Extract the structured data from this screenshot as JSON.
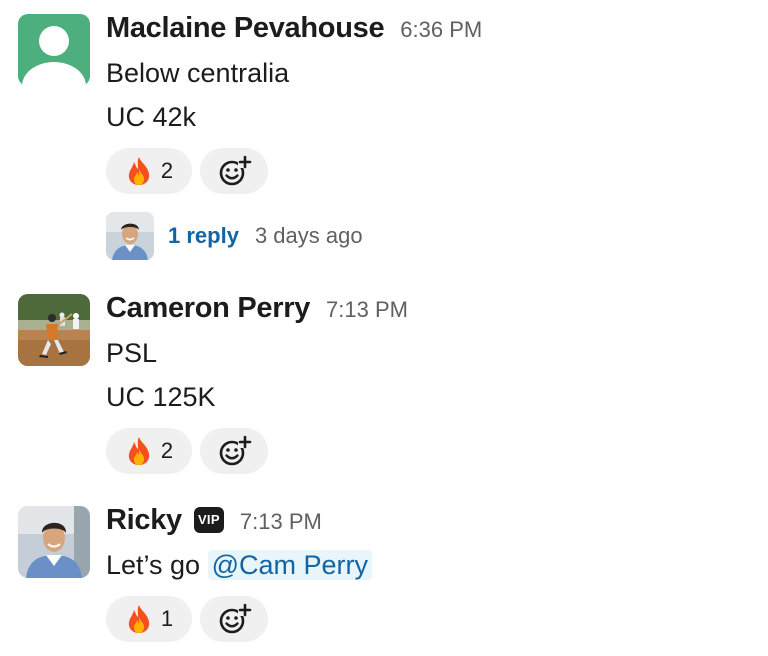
{
  "messages": [
    {
      "author": "Maclaine Pevahouse",
      "time": "6:36 PM",
      "lines": [
        "Below centralia",
        "UC 42k"
      ],
      "reaction": {
        "emoji": "fire",
        "count": "2"
      },
      "thread": {
        "replies": "1 reply",
        "time": "3 days ago"
      }
    },
    {
      "author": "Cameron Perry",
      "time": "7:13 PM",
      "lines": [
        "PSL",
        "UC 125K"
      ],
      "reaction": {
        "emoji": "fire",
        "count": "2"
      }
    },
    {
      "author": "Ricky",
      "badge": "VIP",
      "time": "7:13 PM",
      "text": "Let’s go",
      "mention": "@Cam Perry",
      "reaction": {
        "emoji": "fire",
        "count": "1"
      }
    }
  ],
  "colors": {
    "link": "#1264a3",
    "mention_bg": "#e8f5fa",
    "default_avatar": "#4caf7d",
    "reaction_bg": "#f0f0f0",
    "timestamp": "#616061"
  },
  "icons": [
    "default-user-avatar-icon",
    "fire-emoji-icon",
    "add-reaction-icon",
    "vip-badge-icon"
  ]
}
